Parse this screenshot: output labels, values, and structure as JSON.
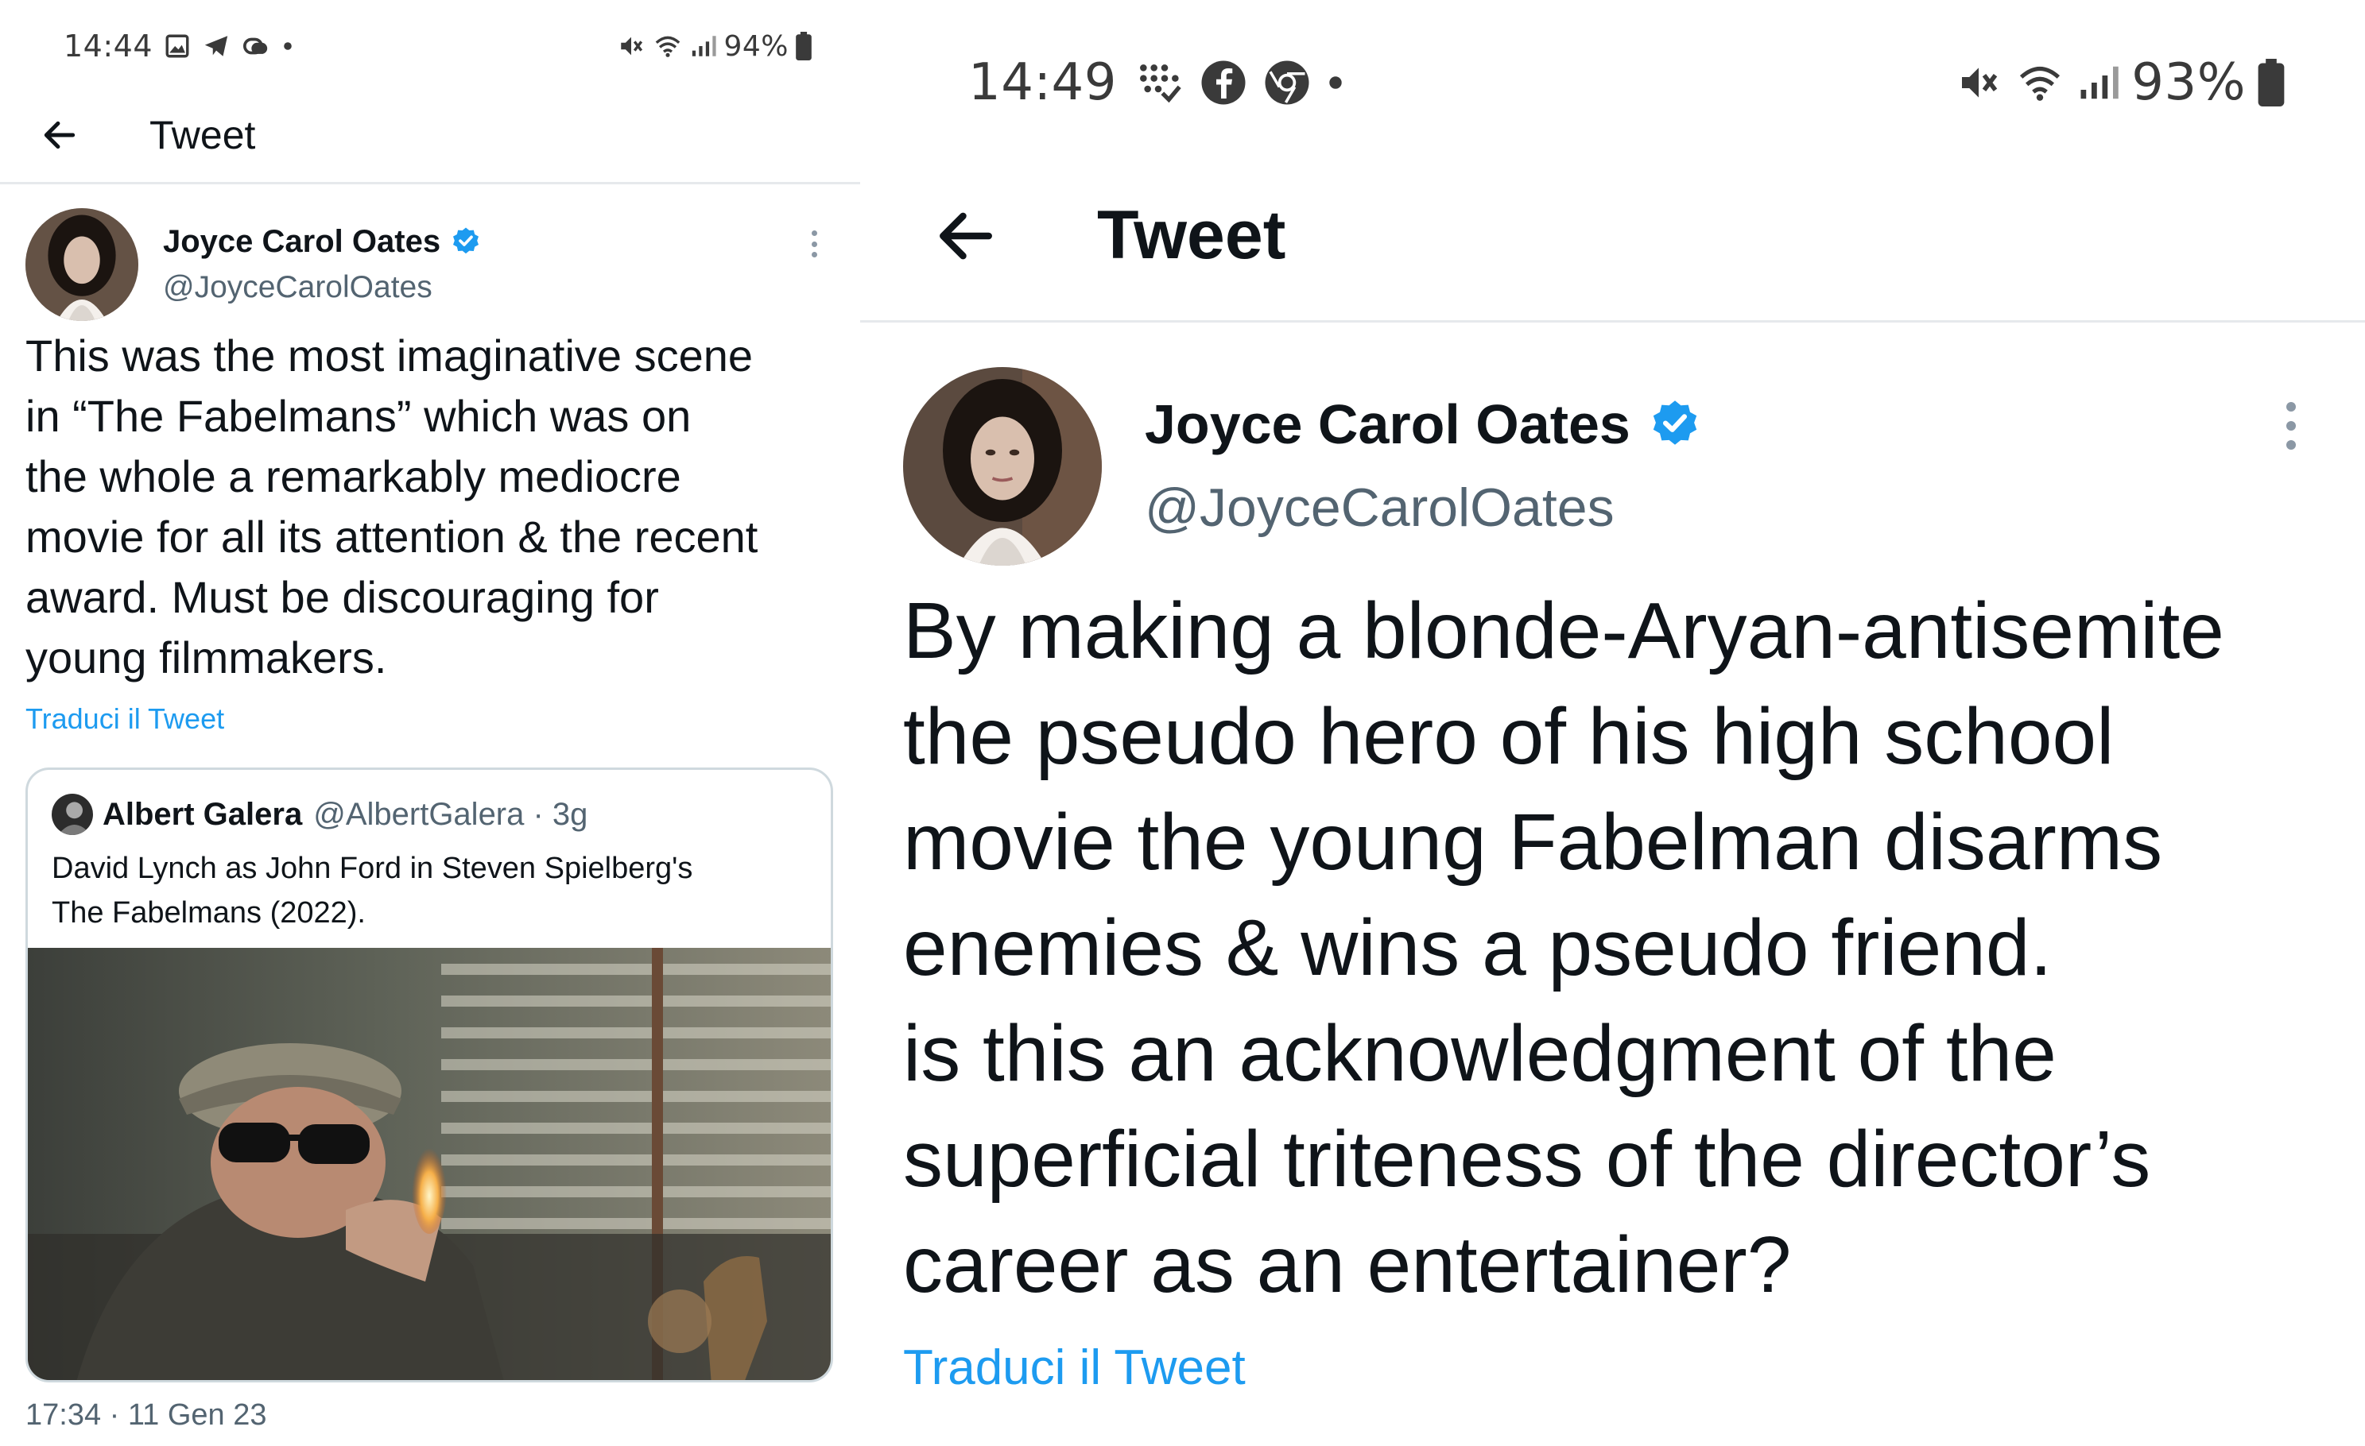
{
  "left": {
    "status_bar": {
      "time": "14:44",
      "battery": "94%",
      "notification_icons": [
        "gallery-icon",
        "telegram-icon",
        "link-icon",
        "dot-icon"
      ],
      "system_icons": [
        "mute-icon",
        "wifi-icon",
        "signal-icon",
        "battery-icon"
      ]
    },
    "header": {
      "title": "Tweet"
    },
    "tweet": {
      "author": {
        "name": "Joyce Carol Oates",
        "handle": "@JoyceCarolOates",
        "verified": true
      },
      "text": "This was the most imaginative scene\nin “The Fabelmans” which was on\nthe whole a remarkably mediocre\nmovie for all its attention & the recent\naward. Must be discouraging for\nyoung filmmakers.",
      "translate_label": "Traduci il Tweet",
      "quote": {
        "name": "Albert Galera",
        "handle_time": "@AlbertGalera · 3g",
        "text": "David Lynch as John Ford in Steven Spielberg's\nThe Fabelmans (2022)."
      },
      "timestamp": "17:34 · 11 Gen 23"
    }
  },
  "right": {
    "status_bar": {
      "time": "14:49",
      "battery": "93%",
      "notification_icons": [
        "dots-grid-icon",
        "facebook-icon",
        "chrome-icon",
        "dot-icon"
      ],
      "system_icons": [
        "mute-icon",
        "wifi-icon",
        "signal-icon",
        "battery-icon"
      ]
    },
    "header": {
      "title": "Tweet"
    },
    "tweet": {
      "author": {
        "name": "Joyce Carol Oates",
        "handle": "@JoyceCarolOates",
        "verified": true
      },
      "text": "By making a blonde-Aryan-antisemite\nthe pseudo hero of his high school\nmovie the young Fabelman disarms\nenemies & wins a pseudo friend.\nis this an acknowledgment of the\nsuperficial triteness of the director’s\ncareer as an entertainer?",
      "translate_label": "Traduci il Tweet"
    }
  },
  "colors": {
    "link": "#1d9bf0",
    "verified": "#1d9bf0",
    "secondary_text": "#536471",
    "divider": "#e6e9ec"
  }
}
